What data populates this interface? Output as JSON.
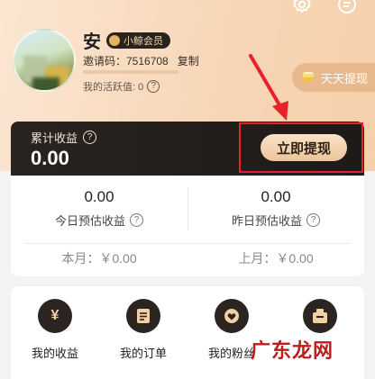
{
  "user": {
    "name": "安",
    "vip_label": "小鲸会员",
    "invite_text": "邀请码：7516708",
    "copy_label": "复制",
    "activity_text": "我的活跃值: 0",
    "activity_progress": 0.0
  },
  "header": {
    "daily_withdraw_label": "天天提现",
    "icons": [
      "gear-icon",
      "message-icon"
    ]
  },
  "earnings": {
    "total_label": "累计收益",
    "total_value": "0.00",
    "withdraw_label": "立即提现"
  },
  "income": {
    "today_value": "0.00",
    "today_label": "今日预估收益",
    "yesterday_value": "0.00",
    "yesterday_label": "昨日预估收益",
    "this_month": "本月：￥0.00",
    "last_month": "上月：￥0.00"
  },
  "grid": {
    "items": [
      {
        "label": "我的收益",
        "icon": "yen-icon"
      },
      {
        "label": "我的订单",
        "icon": "order-icon"
      },
      {
        "label": "我的粉丝",
        "icon": "heart-icon"
      },
      {
        "label": "",
        "icon": "box-icon"
      }
    ]
  },
  "watermark": "广东龙网",
  "colors": {
    "highlight_box": "#e8202a",
    "dark_card": "#1e1a17",
    "gold": "#f3cfa4"
  }
}
